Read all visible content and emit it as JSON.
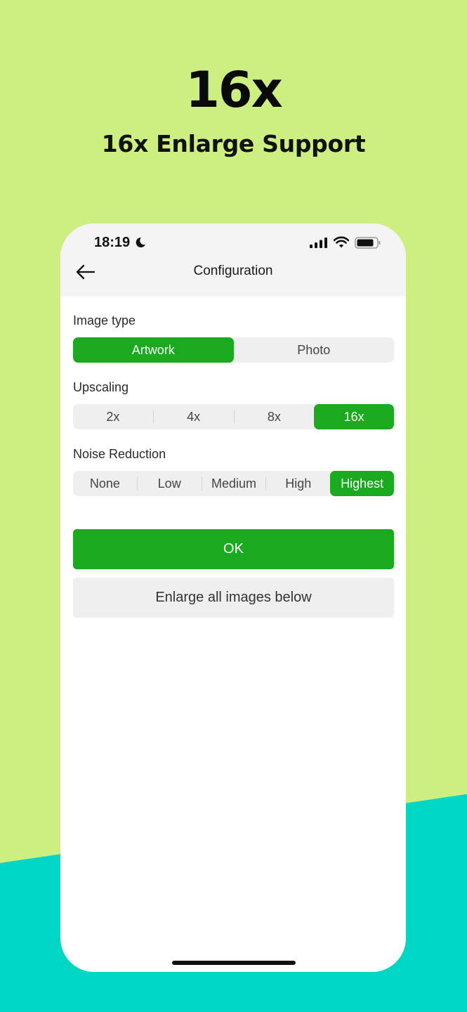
{
  "hero": {
    "title": "16x",
    "subtitle": "16x Enlarge Support"
  },
  "colors": {
    "background_top": "#cdef82",
    "background_bottom": "#00d6c4",
    "accent": "#19aa1f"
  },
  "status_bar": {
    "time": "18:19",
    "icons": [
      "moon-icon",
      "signal-icon",
      "wifi-icon",
      "battery-icon"
    ]
  },
  "nav": {
    "back_icon": "arrow-left-icon",
    "title": "Configuration"
  },
  "image_type": {
    "label": "Image type",
    "options": [
      "Artwork",
      "Photo"
    ],
    "selected": "Artwork"
  },
  "upscaling": {
    "label": "Upscaling",
    "options": [
      "2x",
      "4x",
      "8x",
      "16x"
    ],
    "selected": "16x"
  },
  "noise_reduction": {
    "label": "Noise Reduction",
    "options": [
      "None",
      "Low",
      "Medium",
      "High",
      "Highest"
    ],
    "selected": "Highest"
  },
  "buttons": {
    "ok": "OK",
    "enlarge_all": "Enlarge all images below"
  }
}
